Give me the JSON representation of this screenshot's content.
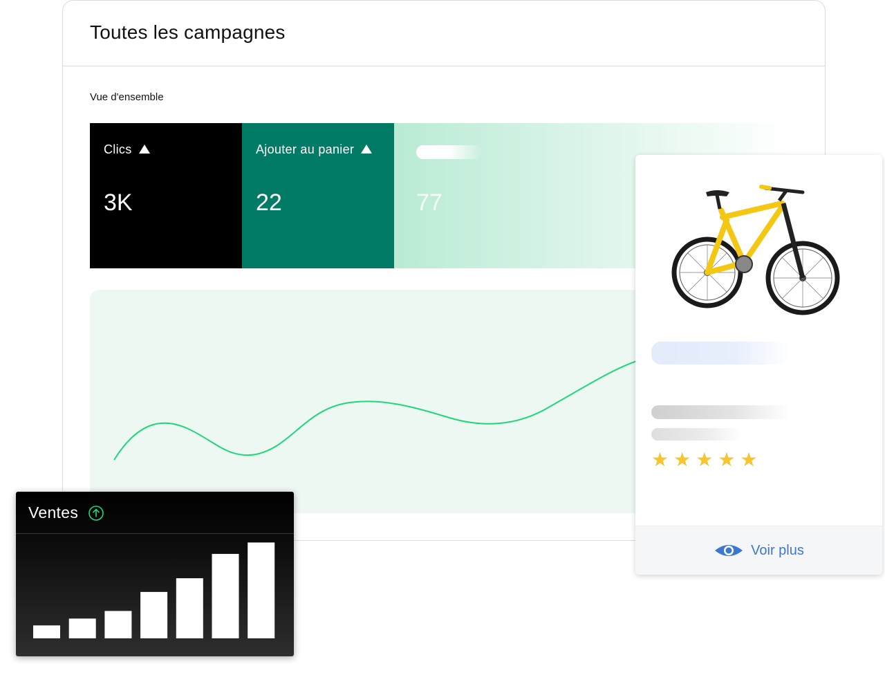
{
  "dashboard": {
    "title": "Toutes les campagnes",
    "overview_label": "Vue d'ensemble",
    "metrics": [
      {
        "label": "Clics",
        "value": "3K",
        "trend_icon": "triangle-up-icon",
        "color": "#000000"
      },
      {
        "label": "Ajouter au panier",
        "value": "22",
        "trend_icon": "triangle-up-icon",
        "color": "#017b66"
      },
      {
        "label": "",
        "value": "77",
        "color": "#b9ebd4"
      }
    ],
    "trend_line": {
      "color": "#1fd67b"
    }
  },
  "product_card": {
    "image": "yellow-bicycle",
    "rating": 5,
    "star_color": "#f7c531",
    "action_label": "Voir plus",
    "action_icon": "eye-icon",
    "accent": "#3c77d0"
  },
  "sales_widget": {
    "title": "Ventes",
    "trend_icon": "arrow-up-circle-icon",
    "trend_color": "#1fd67b",
    "chart_data": {
      "type": "bar",
      "values": [
        17,
        26,
        36,
        61,
        79,
        111,
        126
      ],
      "ylim": [
        0,
        130
      ],
      "bar_color": "#ffffff"
    }
  }
}
